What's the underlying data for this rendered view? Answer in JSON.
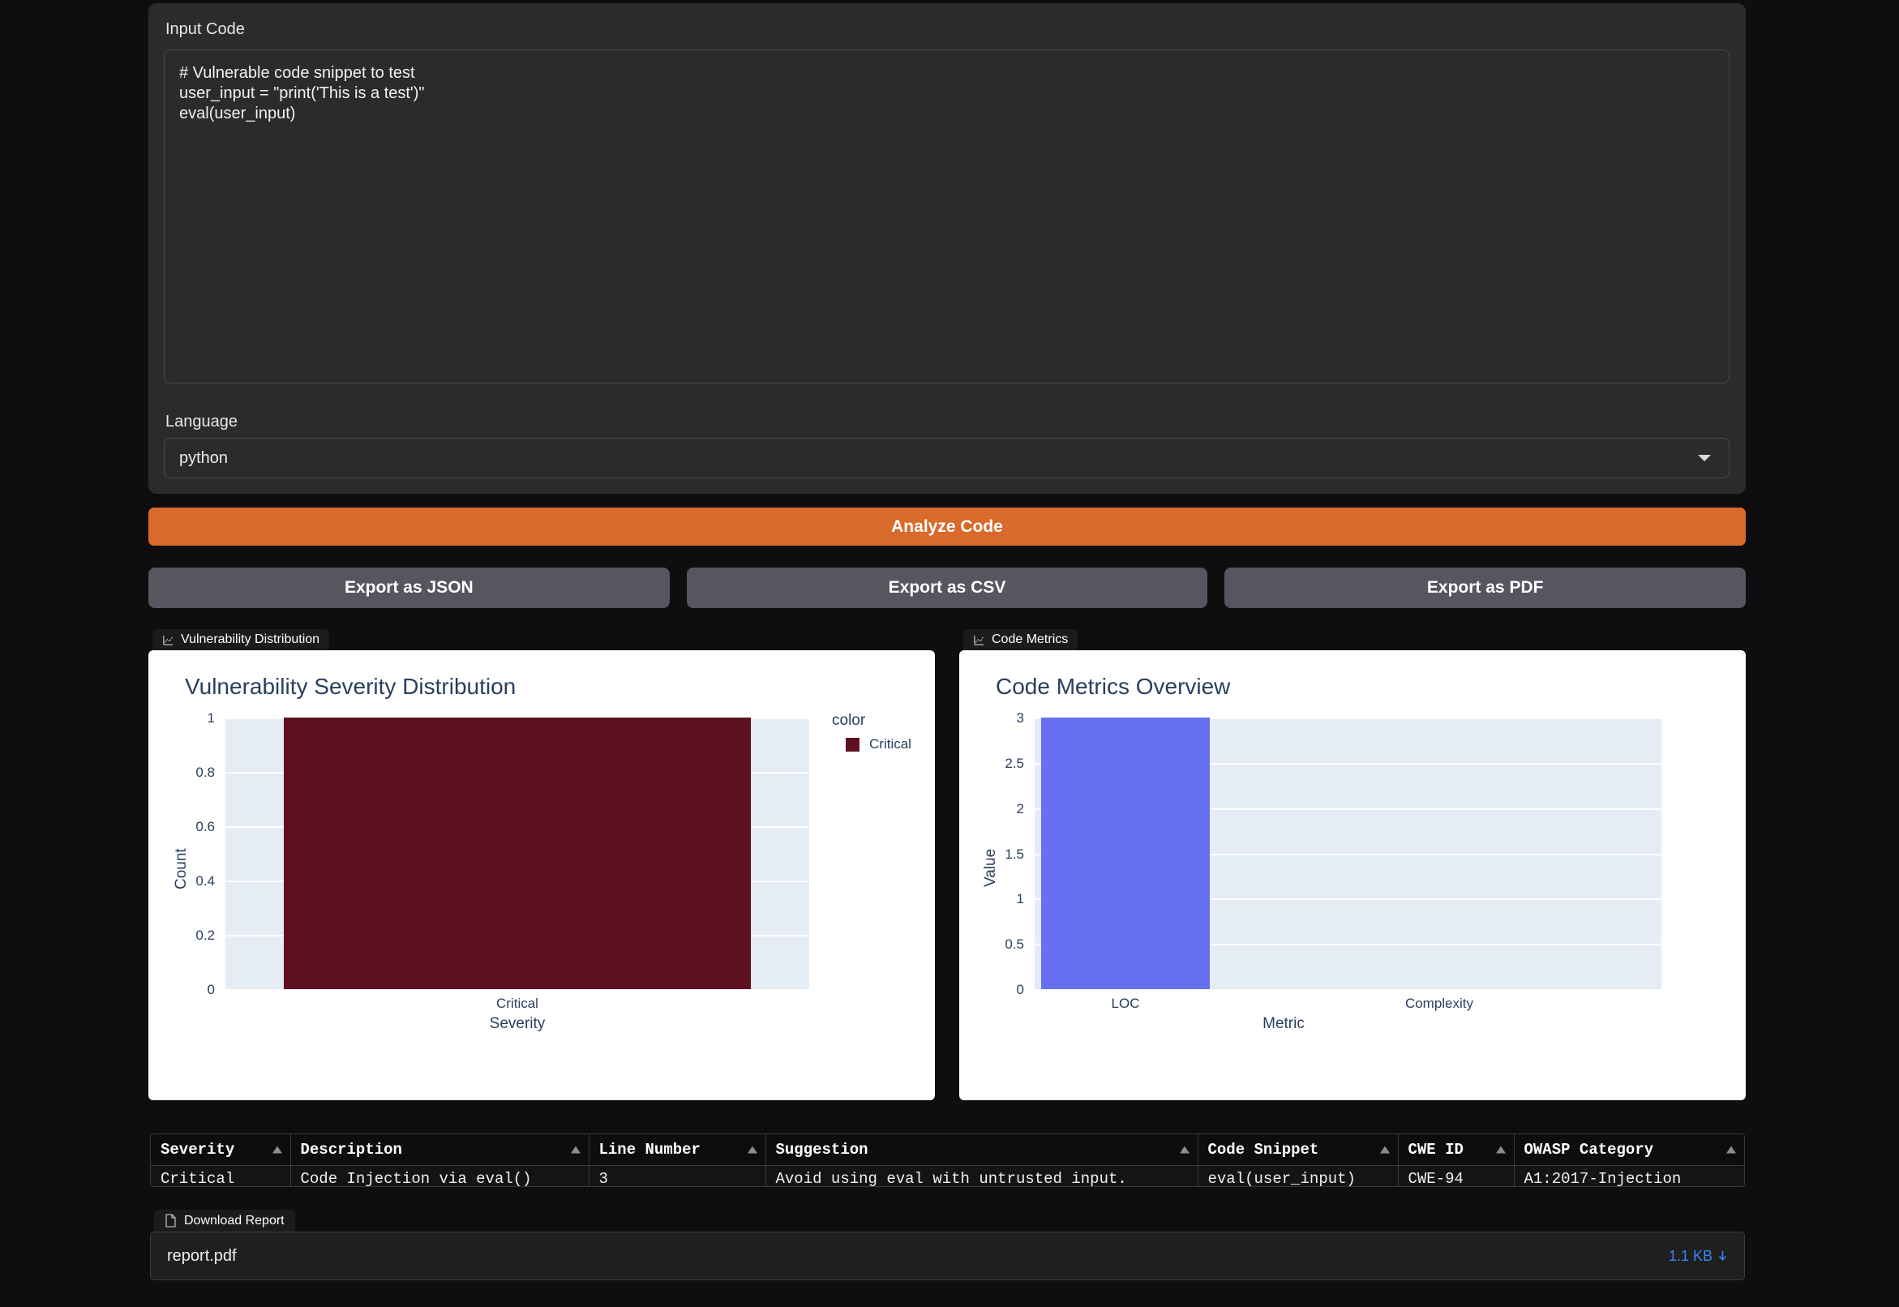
{
  "input_panel": {
    "code_label": "Input Code",
    "code_value": "# Vulnerable code snippet to test\nuser_input = \"print('This is a test')\"\neval(user_input)",
    "language_label": "Language",
    "language_value": "python"
  },
  "actions": {
    "analyze_label": "Analyze Code",
    "export_json_label": "Export as JSON",
    "export_csv_label": "Export as CSV",
    "export_pdf_label": "Export as PDF"
  },
  "tabs": {
    "vuln_tab_label": "Vulnerability Distribution",
    "metrics_tab_label": "Code Metrics"
  },
  "colors": {
    "accent_orange": "#d96a2b",
    "critical_maroon": "#5e1021",
    "metric_blue": "#6670f0",
    "plot_bg": "#e5ecf6",
    "axis_text": "#2a3f5f",
    "link_blue": "#3b82f6"
  },
  "chart_data": [
    {
      "type": "bar",
      "title": "Vulnerability Severity Distribution",
      "categories": [
        "Critical"
      ],
      "values": [
        1
      ],
      "xlabel": "Severity",
      "ylabel": "Count",
      "ylim": [
        0,
        1
      ],
      "yticks": [
        "0",
        "0.2",
        "0.4",
        "0.6",
        "0.8",
        "1"
      ],
      "ytick_values": [
        0,
        0.2,
        0.4,
        0.6,
        0.8,
        1
      ],
      "grid": true,
      "legend_title": "color",
      "legend_position": "right",
      "legend": [
        {
          "name": "Critical",
          "color": "#5e1021"
        }
      ],
      "bar_color": "#5e1021"
    },
    {
      "type": "bar",
      "title": "Code Metrics Overview",
      "categories": [
        "LOC",
        "Complexity"
      ],
      "values": [
        3,
        0
      ],
      "xlabel": "Metric",
      "ylabel": "Value",
      "ylim": [
        0,
        3
      ],
      "yticks": [
        "0",
        "0.5",
        "1",
        "1.5",
        "2",
        "2.5",
        "3"
      ],
      "ytick_values": [
        0,
        0.5,
        1,
        1.5,
        2,
        2.5,
        3
      ],
      "grid": true,
      "legend_position": "none",
      "bar_color": "#6670f0"
    }
  ],
  "results_table": {
    "columns": [
      "Severity",
      "Description",
      "Line Number",
      "Suggestion",
      "Code Snippet",
      "CWE ID",
      "OWASP Category"
    ],
    "rows": [
      {
        "severity": "Critical",
        "description": "Code Injection via eval()",
        "line_number": "3",
        "suggestion": "Avoid using eval with untrusted input.",
        "code_snippet": "eval(user_input)",
        "cwe_id": "CWE-94",
        "owasp_category": "A1:2017-Injection"
      }
    ]
  },
  "download": {
    "tab_label": "Download Report",
    "filename": "report.pdf",
    "filesize": "1.1 KB"
  }
}
